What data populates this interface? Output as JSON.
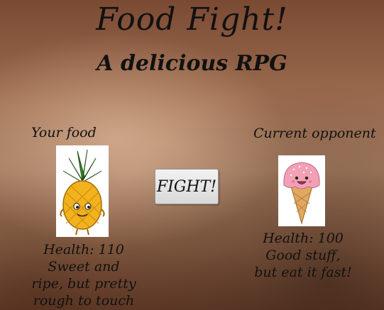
{
  "header": {
    "title": "Food Fight!",
    "subtitle": "A delicious RPG"
  },
  "player": {
    "section_label": "Your food",
    "icon": "pineapple-character",
    "health_text": "Health: 110",
    "description": "Sweet and ripe, but pretty rough to touch"
  },
  "opponent": {
    "section_label": "Current opponent",
    "icon": "ice-cream-cone-character",
    "health_text": "Health: 100",
    "description": "Good stuff, but eat it fast!"
  },
  "actions": {
    "fight_label": "FIGHT!"
  },
  "colors": {
    "pineapple_body": "#f2b21e",
    "pineapple_leaves": "#3d8a2a",
    "ice_cream_scoop": "#f2a0b6",
    "cone": "#e0a860"
  }
}
